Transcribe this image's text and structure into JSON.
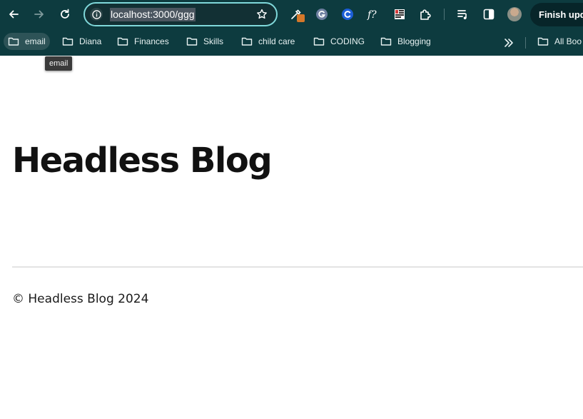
{
  "browser": {
    "address": "localhost:3000/ggg",
    "finish_update_label": "Finish upd",
    "theme": {
      "toolbar": "#0d3b3f",
      "omnibox_ring": "#7fd8da"
    },
    "extensions": [
      "eyedropper-icon",
      "grammarly-icon",
      "circle-c-icon",
      "function-icon",
      "screen-capture-icon",
      "puzzle-extensions-icon",
      "reading-list-icon",
      "side-panel-icon"
    ]
  },
  "bookmarks": {
    "items": [
      {
        "label": "email"
      },
      {
        "label": "Diana"
      },
      {
        "label": "Finances"
      },
      {
        "label": "Skills"
      },
      {
        "label": "child care"
      },
      {
        "label": "CODING"
      },
      {
        "label": "Blogging"
      }
    ],
    "all_label": "All Boo",
    "tooltip": "email"
  },
  "page": {
    "title": "Headless Blog",
    "footer": "© Headless Blog 2024"
  }
}
